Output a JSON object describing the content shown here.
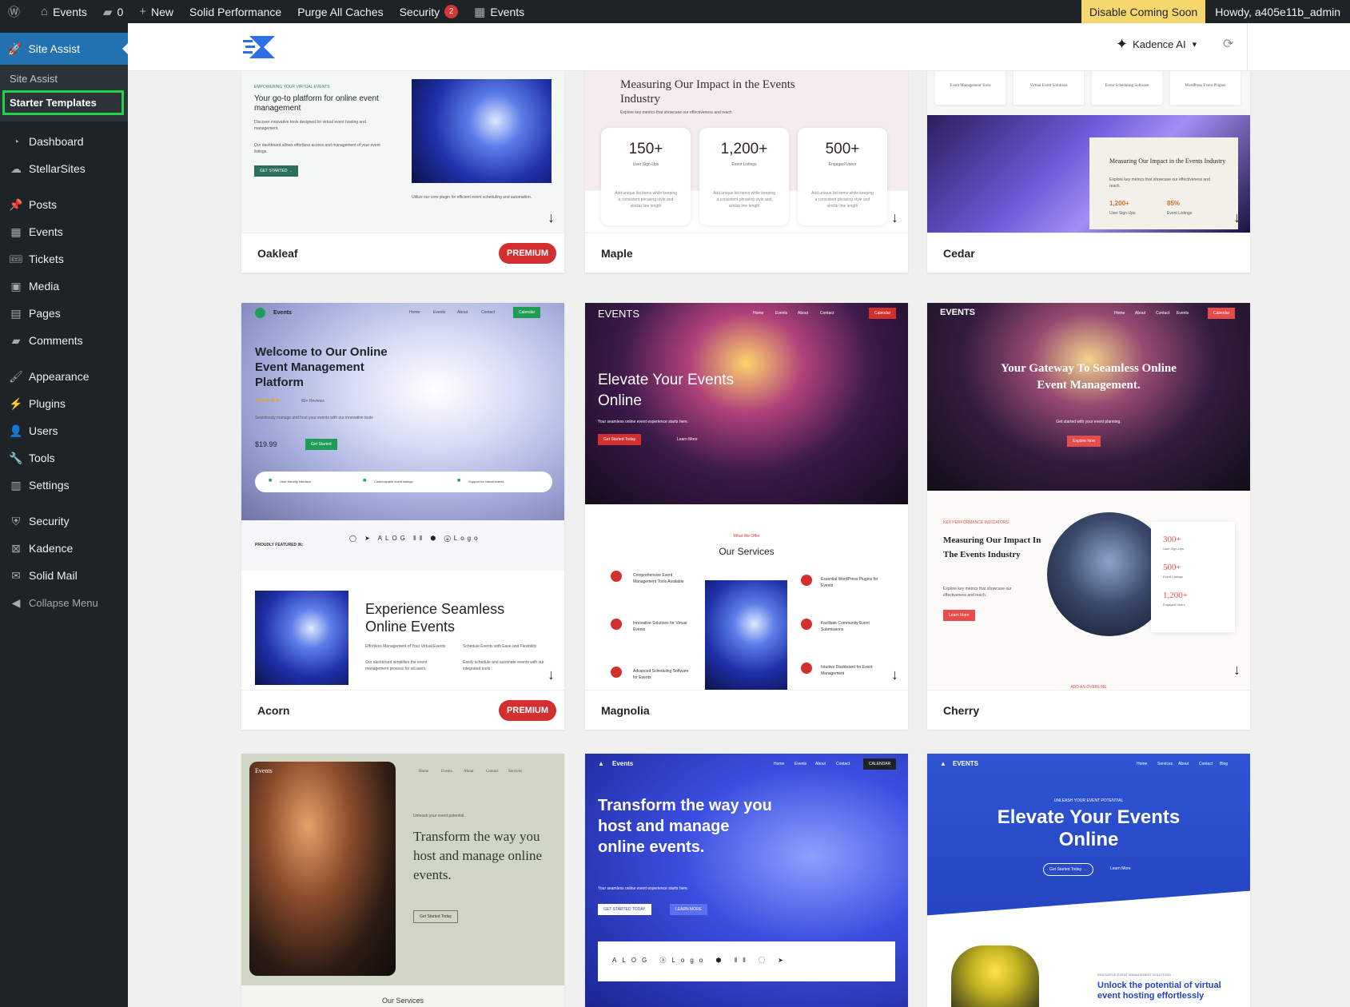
{
  "admin_bar": {
    "site_name": "Events",
    "comments_count": "0",
    "new_label": "New",
    "solid_performance": "Solid Performance",
    "purge_caches": "Purge All Caches",
    "security_label": "Security",
    "security_count": "2",
    "events_label": "Events",
    "coming_soon": "Disable Coming Soon",
    "howdy": "Howdy, a405e11b_admin"
  },
  "sidebar": {
    "site_assist": "Site Assist",
    "sub_site_assist": "Site Assist",
    "sub_starter_templates": "Starter Templates",
    "items": [
      {
        "label": "Dashboard",
        "icon": "dashboard-icon"
      },
      {
        "label": "StellarSites",
        "icon": "stellarsites-icon"
      },
      {
        "label": "Posts",
        "icon": "pin-icon"
      },
      {
        "label": "Events",
        "icon": "calendar-icon"
      },
      {
        "label": "Tickets",
        "icon": "ticket-icon"
      },
      {
        "label": "Media",
        "icon": "media-icon"
      },
      {
        "label": "Pages",
        "icon": "page-icon"
      },
      {
        "label": "Comments",
        "icon": "comment-icon"
      },
      {
        "label": "Appearance",
        "icon": "brush-icon"
      },
      {
        "label": "Plugins",
        "icon": "plug-icon"
      },
      {
        "label": "Users",
        "icon": "user-icon"
      },
      {
        "label": "Tools",
        "icon": "wrench-icon"
      },
      {
        "label": "Settings",
        "icon": "settings-icon"
      },
      {
        "label": "Security",
        "icon": "shield-icon"
      },
      {
        "label": "Kadence",
        "icon": "kadence-icon"
      },
      {
        "label": "Solid Mail",
        "icon": "mail-icon"
      }
    ],
    "collapse": "Collapse Menu"
  },
  "header": {
    "kadence_ai": "Kadence AI"
  },
  "templates": {
    "premium_label": "PREMIUM",
    "oakleaf": {
      "name": "Oakleaf",
      "eyebrow": "EMPOWERING YOUR VIRTUAL EVENTS",
      "headline": "Your go-to platform for online event management",
      "body1": "Discover innovative tools designed for virtual event hosting and management.",
      "body2": "Our dashboard allows effortless access and management of your event listings.",
      "cta": "GET STARTED →",
      "caption": "Utilize our core plugin for efficient event scheduling and automation."
    },
    "maple": {
      "name": "Maple",
      "headline": "Measuring Our Impact in the Events Industry",
      "sub": "Explore key metrics that showcase our effectiveness and reach",
      "stats": [
        {
          "value": "150+",
          "label": "User Sign-Ups"
        },
        {
          "value": "1,200+",
          "label": "Event Listings"
        },
        {
          "value": "500+",
          "label": "Engaged Users"
        }
      ],
      "stat_body": "Add unique list items while keeping a consistent phrasing style and similar line length"
    },
    "cedar": {
      "name": "Cedar",
      "icons": [
        "Event Management Tools",
        "Virtual Event Solutions",
        "Event Scheduling Software",
        "WordPress Event Plugins"
      ],
      "headline": "Measuring Our Impact in the Events Industry",
      "sub": "Explore key metrics that showcase our effectiveness and reach.",
      "stat1_value": "1,200+",
      "stat1_label": "User Sign-Ups",
      "stat2_value": "85%",
      "stat2_label": "Event Listings"
    },
    "acorn": {
      "name": "Acorn",
      "nav_brand": "Events",
      "nav": [
        "Home",
        "Events",
        "About",
        "Contact"
      ],
      "nav_cta": "Calendar",
      "headline": "Welcome to Our Online Event Management Platform",
      "reviews": "80+ Reviews",
      "body": "Seamlessly manage and host your events with our innovative tools",
      "price": "$19.99",
      "cta": "Get Started",
      "features": [
        "User-friendly interface",
        "Customizable event listings",
        "Support for virtual events"
      ],
      "featured_label": "PROUDLY FEATURED IN:",
      "section_title": "Experience Seamless Online Events",
      "col1_title": "Effortless Management of Your Virtual Events",
      "col1_body": "Our dashboard simplifies the event management process for all users.",
      "col2_title": "Schedule Events with Ease and Flexibility",
      "col2_body": "Easily schedule and automate events with our integrated tools."
    },
    "magnolia": {
      "name": "Magnolia",
      "brand": "EVENTS",
      "nav": [
        "Home",
        "Events",
        "About",
        "Contact"
      ],
      "nav_cta": "Calendar",
      "headline": "Elevate Your Events Online",
      "sub": "Your seamless online event experience starts here.",
      "cta1": "Get Started Today",
      "cta2": "Learn More",
      "eyebrow": "What We Offer",
      "section_title": "Our Services",
      "services_left": [
        "Comprehensive Event Management Tools Available",
        "Innovative Solutions for Virtual Events",
        "Advanced Scheduling Software for Events"
      ],
      "services_right": [
        "Essential WordPress Plugins for Events",
        "Facilitate Community Event Submissions",
        "Intuitive Dashboard for Event Management"
      ]
    },
    "cherry": {
      "name": "Cherry",
      "brand": "EVENTS",
      "nav": [
        "Home",
        "About",
        "Contact",
        "Events"
      ],
      "nav_cta": "Calendar",
      "headline": "Your Gateway To Seamless Online Event Management.",
      "sub": "Get started with your event planning.",
      "cta": "Explore Now",
      "eyebrow": "KEY PERFORMANCE INDICATORS",
      "section_title": "Measuring Our Impact In The Events Industry",
      "section_body": "Explore key metrics that showcase our effectiveness and reach.",
      "section_cta": "Learn More",
      "stats": [
        {
          "value": "300+",
          "label": "User Sign-Ups"
        },
        {
          "value": "500+",
          "label": "Event Listings"
        },
        {
          "value": "1,200+",
          "label": "Engaged Users"
        }
      ],
      "footer_eyebrow": "ADD AN OVERLINE"
    },
    "row3_1": {
      "brand": "Events",
      "nav": [
        "Home",
        "Events",
        "About",
        "Contact",
        "Services"
      ],
      "eyebrow": "Unleash your event potential.",
      "headline": "Transform the way you host and manage online events.",
      "cta": "Get Started Today",
      "bottom": "Our Services"
    },
    "row3_2": {
      "brand": "Events",
      "nav": [
        "Home",
        "Events",
        "About",
        "Contact"
      ],
      "nav_cta": "CALENDAR",
      "headline": "Transform the way you host and manage online events.",
      "sub": "Your seamless online event experience starts here.",
      "cta1": "GET STARTED TODAY",
      "cta2": "LEARN MORE"
    },
    "row3_3": {
      "brand": "EVENTS",
      "nav": [
        "Home",
        "Services",
        "About",
        "Contact",
        "Blog"
      ],
      "eyebrow": "UNLEASH YOUR EVENT POTENTIAL",
      "headline": "Elevate Your Events Online",
      "cta1": "Get Started Today →",
      "cta2": "Learn More",
      "sub_eyebrow": "INNOVATIVE EVENT MANAGEMENT SOLUTIONS",
      "sub_title": "Unlock the potential of virtual event hosting effortlessly"
    }
  },
  "colors": {
    "wp_dark": "#1d2327",
    "wp_blue": "#2271b1",
    "highlight_green": "#1ed34a",
    "premium_red": "#d32f2f",
    "coming_soon_yellow": "#f5d76e"
  }
}
